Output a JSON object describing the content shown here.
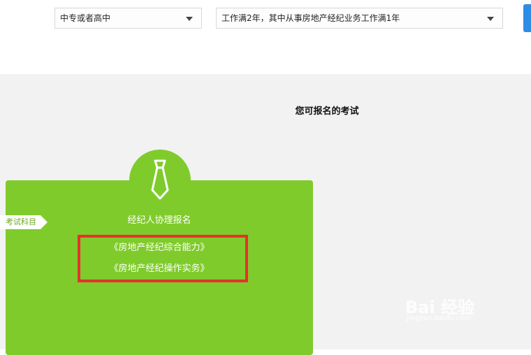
{
  "filters": {
    "education_value": "中专或者高中",
    "experience_value": "工作满2年，其中从事房地产经纪业务工作满1年"
  },
  "section": {
    "title": "您可报名的考试"
  },
  "card": {
    "icon": "tie-icon",
    "title": "经纪人协理报名",
    "tag": "考试科目",
    "subjects": [
      "《房地产经纪综合能力》",
      "《房地产经纪操作实务》"
    ],
    "accent_color": "#7fcb2b",
    "highlight_color": "#e8302d"
  },
  "watermark": {
    "brand": "Bai 经验",
    "url": "jingyan.baidu.com"
  }
}
